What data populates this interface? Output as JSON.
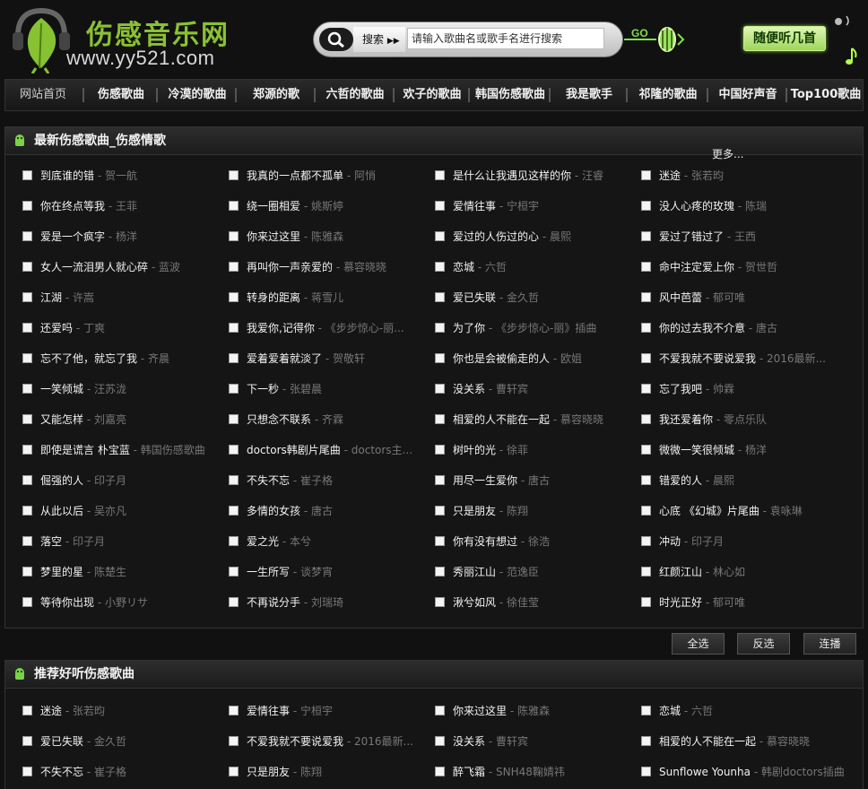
{
  "site": {
    "name": "伤感音乐网",
    "domain": "www.yy521.com"
  },
  "search": {
    "label": "搜索",
    "placeholder": "请输入歌曲名或歌手名进行搜索",
    "go": "GO"
  },
  "random_label": "随便听几首",
  "nav": [
    "网站首页",
    "伤感歌曲",
    "冷漠的歌曲",
    "郑源的歌",
    "六哲的歌曲",
    "欢子的歌曲",
    "韩国伤感歌曲",
    "我是歌手",
    "祁隆的歌曲",
    "中国好声音",
    "Top100歌曲"
  ],
  "latest": {
    "title": "最新伤感歌曲_伤感情歌",
    "more": "更多...",
    "songs": [
      [
        "到底谁的错",
        "- 贺一航"
      ],
      [
        "我真的一点都不孤单",
        "- 阿悄"
      ],
      [
        "是什么让我遇见这样的你",
        "- 汪睿"
      ],
      [
        "迷途",
        "- 张若昀"
      ],
      [
        "你在终点等我",
        "- 王菲"
      ],
      [
        "绕一圈相爱",
        "- 姚斯婷"
      ],
      [
        "爱情往事",
        "- 宁桓宇"
      ],
      [
        "没人心疼的玫瑰",
        "- 陈瑞"
      ],
      [
        "爱是一个疯字",
        "- 杨洋"
      ],
      [
        "你来过这里",
        "- 陈雅森"
      ],
      [
        "爱过的人伤过的心",
        "- 晨熙"
      ],
      [
        "爱过了错过了",
        "- 王西"
      ],
      [
        "女人一流泪男人就心碎",
        "- 蓝波"
      ],
      [
        "再叫你一声亲爱的",
        "- 慕容晓晓"
      ],
      [
        "恋城",
        "- 六哲"
      ],
      [
        "命中注定爱上你",
        "- 贺世哲"
      ],
      [
        "江湖",
        "- 许嵩"
      ],
      [
        "转身的距离",
        "- 蒋雪儿"
      ],
      [
        "爱已失联",
        "- 金久哲"
      ],
      [
        "风中芭蕾",
        "- 郁可唯"
      ],
      [
        "还爱吗",
        "- 丁爽"
      ],
      [
        "我爱你,记得你",
        "- 《步步惊心-丽..."
      ],
      [
        "为了你",
        "- 《步步惊心-丽》插曲"
      ],
      [
        "你的过去我不介意",
        "- 唐古"
      ],
      [
        "忘不了他，就忘了我",
        "- 齐晨"
      ],
      [
        "爱着爱着就淡了",
        "- 贺敬轩"
      ],
      [
        "你也是会被偷走的人",
        "- 欧姐"
      ],
      [
        "不爱我就不要说爱我",
        "- 2016最新..."
      ],
      [
        "一笑倾城",
        "- 汪苏泷"
      ],
      [
        "下一秒",
        "- 张碧晨"
      ],
      [
        "没关系",
        "- 曹轩宾"
      ],
      [
        "忘了我吧",
        "- 帅霖"
      ],
      [
        "又能怎样",
        "- 刘嘉亮"
      ],
      [
        "只想念不联系",
        "- 齐霖"
      ],
      [
        "相爱的人不能在一起",
        "- 慕容晓晓"
      ],
      [
        "我还爱着你",
        "- 零点乐队"
      ],
      [
        "即使是谎言 朴宝蓝",
        "- 韩国伤感歌曲"
      ],
      [
        "doctors韩剧片尾曲",
        "- doctors主..."
      ],
      [
        "树叶的光",
        "- 徐菲"
      ],
      [
        "微微一笑很倾城",
        "- 杨洋"
      ],
      [
        "倔强的人",
        "- 印子月"
      ],
      [
        "不失不忘",
        "- 崔子格"
      ],
      [
        "用尽一生爱你",
        "- 唐古"
      ],
      [
        "错爱的人",
        "- 晨熙"
      ],
      [
        "从此以后",
        "- 吴亦凡"
      ],
      [
        "多情的女孩",
        "- 唐古"
      ],
      [
        "只是朋友",
        "- 陈翔"
      ],
      [
        "心底 《幻城》片尾曲",
        "- 袁咏琳"
      ],
      [
        "落空",
        "- 印子月"
      ],
      [
        "爱之光",
        "- 本兮"
      ],
      [
        "你有没有想过",
        "- 徐浩"
      ],
      [
        "冲动",
        "- 印子月"
      ],
      [
        "梦里的星",
        "- 陈楚生"
      ],
      [
        "一生所写",
        "- 谈梦宵"
      ],
      [
        "秀丽江山",
        "- 范逸臣"
      ],
      [
        "红颜江山",
        "- 林心如"
      ],
      [
        "等待你出现",
        "- 小野リサ"
      ],
      [
        "不再说分手",
        "- 刘瑞琦"
      ],
      [
        "湫兮如风",
        "- 徐佳莹"
      ],
      [
        "时光正好",
        "- 郁可唯"
      ]
    ]
  },
  "buttons": {
    "select_all": "全选",
    "invert": "反选",
    "play": "连播"
  },
  "recommended": {
    "title": "推荐好听伤感歌曲",
    "songs": [
      [
        "迷途",
        "- 张若昀"
      ],
      [
        "爱情往事",
        "- 宁桓宇"
      ],
      [
        "你来过这里",
        "- 陈雅森"
      ],
      [
        "恋城",
        "- 六哲"
      ],
      [
        "爱已失联",
        "- 金久哲"
      ],
      [
        "不爱我就不要说爱我",
        "- 2016最新..."
      ],
      [
        "没关系",
        "- 曹轩宾"
      ],
      [
        "相爱的人不能在一起",
        "- 慕容晓晓"
      ],
      [
        "不失不忘",
        "- 崔子格"
      ],
      [
        "只是朋友",
        "- 陈翔"
      ],
      [
        "醉飞霜",
        "- SNH48鞠婧祎"
      ],
      [
        "Sunflowe Younha",
        "- 韩剧doctors插曲"
      ]
    ]
  }
}
